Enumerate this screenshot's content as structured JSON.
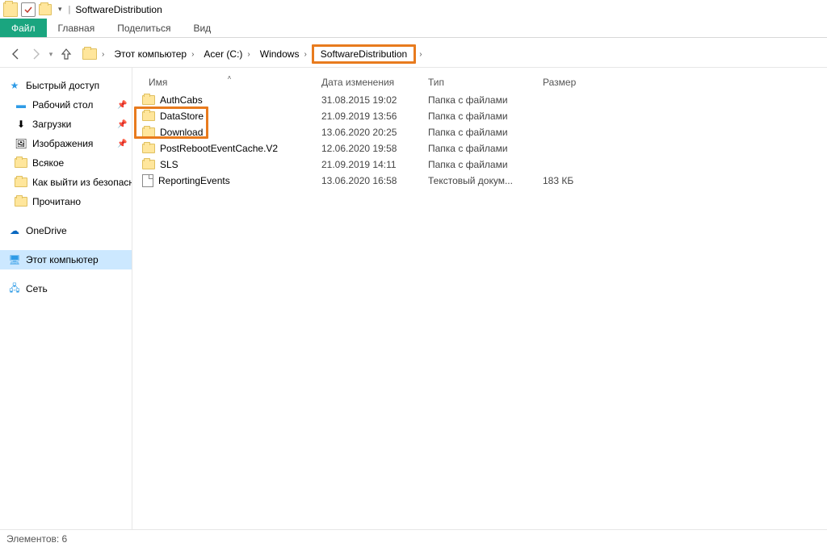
{
  "titlebar": {
    "title": "SoftwareDistribution"
  },
  "ribbon": {
    "file": "Файл",
    "tabs": [
      "Главная",
      "Поделиться",
      "Вид"
    ]
  },
  "breadcrumbs": [
    {
      "label": "Этот компьютер"
    },
    {
      "label": "Acer (C:)"
    },
    {
      "label": "Windows"
    },
    {
      "label": "SoftwareDistribution",
      "highlight": true
    }
  ],
  "sidebar": {
    "quick_access": {
      "label": "Быстрый доступ",
      "items": [
        {
          "label": "Рабочий стол",
          "pinned": true,
          "icon": "desktop"
        },
        {
          "label": "Загрузки",
          "pinned": true,
          "icon": "download"
        },
        {
          "label": "Изображения",
          "pinned": true,
          "icon": "images"
        },
        {
          "label": "Всякое",
          "icon": "folder"
        },
        {
          "label": "Как выйти из безопасного режима",
          "icon": "folder"
        },
        {
          "label": "Прочитано",
          "icon": "folder"
        }
      ]
    },
    "onedrive": {
      "label": "OneDrive"
    },
    "this_pc": {
      "label": "Этот компьютер",
      "selected": true
    },
    "network": {
      "label": "Сеть"
    }
  },
  "columns": {
    "name": "Имя",
    "date": "Дата изменения",
    "type": "Тип",
    "size": "Размер"
  },
  "rows": [
    {
      "name": "AuthCabs",
      "date": "31.08.2015 19:02",
      "type": "Папка с файлами",
      "size": "",
      "kind": "folder"
    },
    {
      "name": "DataStore",
      "date": "21.09.2019 13:56",
      "type": "Папка с файлами",
      "size": "",
      "kind": "folder",
      "highlight": true
    },
    {
      "name": "Download",
      "date": "13.06.2020 20:25",
      "type": "Папка с файлами",
      "size": "",
      "kind": "folder",
      "highlight": true
    },
    {
      "name": "PostRebootEventCache.V2",
      "date": "12.06.2020 19:58",
      "type": "Папка с файлами",
      "size": "",
      "kind": "folder"
    },
    {
      "name": "SLS",
      "date": "21.09.2019 14:11",
      "type": "Папка с файлами",
      "size": "",
      "kind": "folder"
    },
    {
      "name": "ReportingEvents",
      "date": "13.06.2020 16:58",
      "type": "Текстовый докум...",
      "size": "183 КБ",
      "kind": "file"
    }
  ],
  "statusbar": {
    "text": "Элементов: 6"
  }
}
